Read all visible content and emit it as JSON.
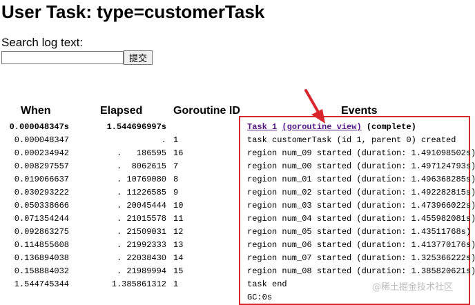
{
  "page": {
    "title": "User Task: type=customerTask",
    "search_label": "Search log text:",
    "search_value": "",
    "submit_label": "提交"
  },
  "table": {
    "headers": {
      "when": "When",
      "elapsed": "Elapsed",
      "goroutine": "Goroutine ID",
      "events": "Events"
    },
    "task_row": {
      "when": "0.000048347s",
      "elapsed": "1.544696997s",
      "task_link": "Task 1",
      "goroutine_link": "(goroutine view)",
      "status": "(complete)"
    },
    "rows": [
      {
        "when": "0.000048347",
        "elapsed": ".",
        "gid": "1",
        "event": "task customerTask (id 1, parent 0) created"
      },
      {
        "when": "0.000234942",
        "elapsed": ".   186595",
        "gid": "16",
        "event": "region num_09 started (duration: 1.491098502s)"
      },
      {
        "when": "0.008297557",
        "elapsed": ".  8062615",
        "gid": "7",
        "event": "region num_00 started (duration: 1.497124793s)"
      },
      {
        "when": "0.019066637",
        "elapsed": ". 10769080",
        "gid": "8",
        "event": "region num_01 started (duration: 1.496368285s)"
      },
      {
        "when": "0.030293222",
        "elapsed": ". 11226585",
        "gid": "9",
        "event": "region num_02 started (duration: 1.492282815s)"
      },
      {
        "when": "0.050338666",
        "elapsed": ". 20045444",
        "gid": "10",
        "event": "region num_03 started (duration: 1.473966022s)"
      },
      {
        "when": "0.071354244",
        "elapsed": ". 21015578",
        "gid": "11",
        "event": "region num_04 started (duration: 1.455982081s)"
      },
      {
        "when": "0.092863275",
        "elapsed": ". 21509031",
        "gid": "12",
        "event": "region num_05 started (duration: 1.43511768s)"
      },
      {
        "when": "0.114855608",
        "elapsed": ". 21992333",
        "gid": "13",
        "event": "region num_06 started (duration: 1.413770176s)"
      },
      {
        "when": "0.136894038",
        "elapsed": ". 22038430",
        "gid": "14",
        "event": "region num_07 started (duration: 1.325366222s)"
      },
      {
        "when": "0.158884032",
        "elapsed": ". 21989994",
        "gid": "15",
        "event": "region num_08 started (duration: 1.385820621s)"
      },
      {
        "when": "1.544745344",
        "elapsed": "1.385861312",
        "gid": "1",
        "event": "task end"
      },
      {
        "when": "",
        "elapsed": "",
        "gid": "",
        "event": "GC:0s"
      }
    ]
  },
  "annotation": {
    "box_color": "#d9262c",
    "arrow_color": "#d9262c"
  },
  "watermark": "@稀土掘金技术社区"
}
